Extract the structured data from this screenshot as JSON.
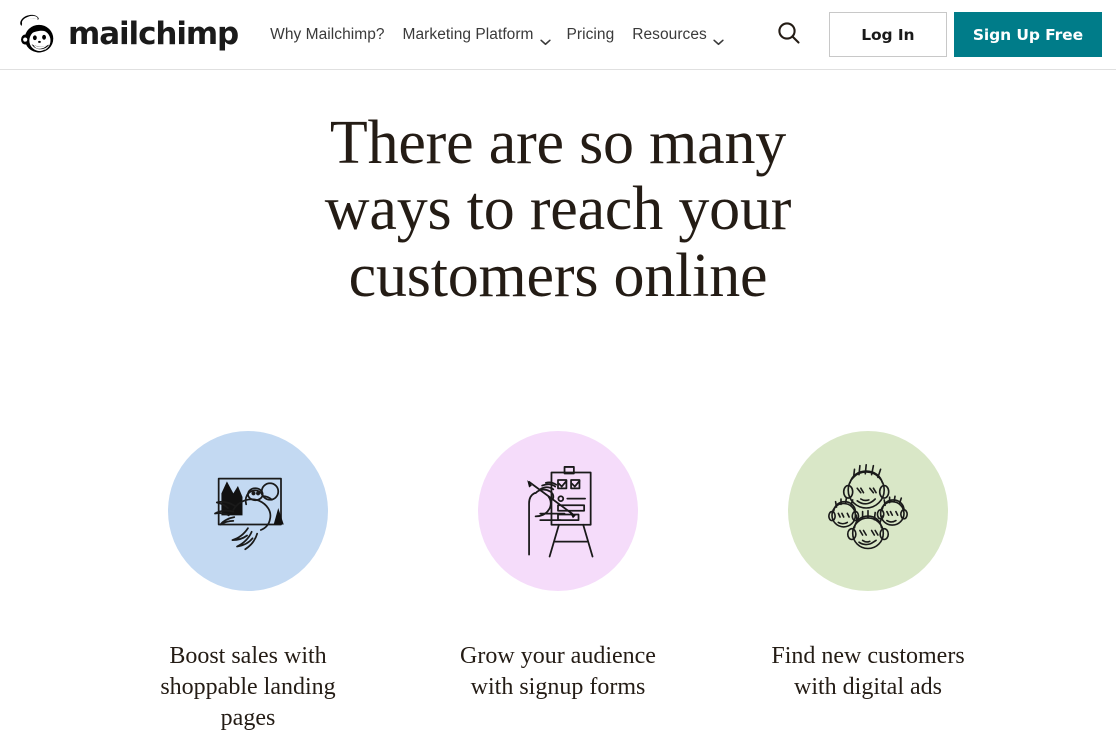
{
  "brand": {
    "name": "mailchimp",
    "logo_icon": "mailchimp-freddie-chimp-icon",
    "accent_teal": "#007C89",
    "text_color": "#241C15"
  },
  "header": {
    "nav": [
      {
        "label": "Why Mailchimp?",
        "has_dropdown": false
      },
      {
        "label": "Marketing Platform",
        "has_dropdown": true
      },
      {
        "label": "Pricing",
        "has_dropdown": false
      },
      {
        "label": "Resources",
        "has_dropdown": true
      }
    ],
    "search_icon": "search-icon",
    "login_label": "Log In",
    "signup_label": "Sign Up Free"
  },
  "hero": {
    "title": "There are so many ways to reach your customers online"
  },
  "cards": [
    {
      "label": "Boost sales with shoppable landing pages",
      "circle_color": "#C3D9F2",
      "icon": "crane-bird-landscape-illustration"
    },
    {
      "label": "Grow your audience with signup forms",
      "circle_color": "#F5DCFA",
      "icon": "hand-pencil-signup-form-easel-illustration"
    },
    {
      "label": "Find new customers with digital ads",
      "circle_color": "#D9E7C7",
      "icon": "four-customer-faces-illustration"
    }
  ]
}
